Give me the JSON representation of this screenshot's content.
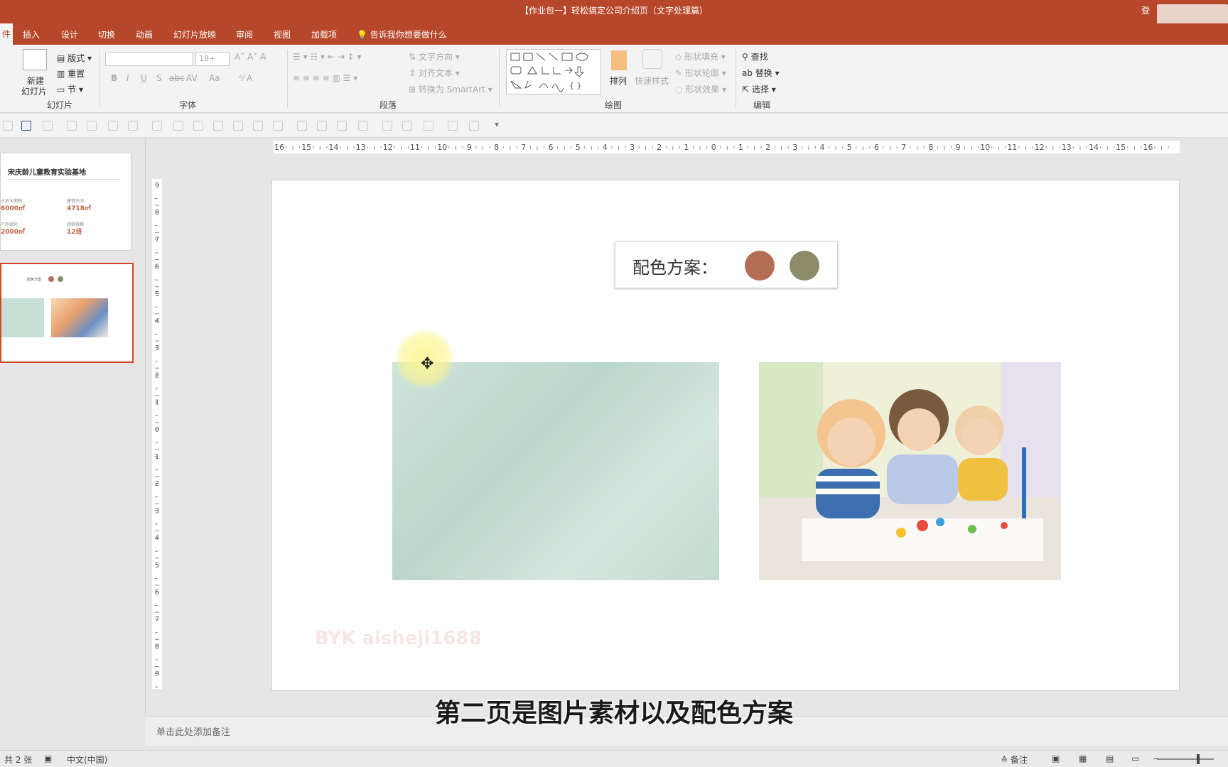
{
  "window": {
    "title": "【作业包一】轻松搞定公司介绍页（文字处理篇）",
    "login": "登"
  },
  "tabs": [
    "插入",
    "设计",
    "切换",
    "动画",
    "幻灯片放映",
    "审阅",
    "视图",
    "加载项"
  ],
  "tell_me": "告诉我你想要做什么",
  "ribbon": {
    "slides": {
      "new_slide": "新建",
      "new_slide2": "幻灯片",
      "layout": "版式",
      "reset": "重置",
      "section": "节",
      "label": "幻灯片"
    },
    "font": {
      "size": "18+",
      "bold": "B",
      "italic": "I",
      "underline": "U",
      "shadow": "S",
      "strike": "abc",
      "spacing": "AV",
      "case": "Aa",
      "label": "字体"
    },
    "paragraph": {
      "text_direction": "文字方向",
      "align_text": "对齐文本",
      "smartart": "转换为 SmartArt",
      "label": "段落"
    },
    "drawing": {
      "arrange": "排列",
      "quick_styles": "快速样式",
      "shape_fill": "形状填充",
      "shape_outline": "形状轮廓",
      "shape_effects": "形状效果",
      "label": "绘图"
    },
    "editing": {
      "find": "查找",
      "replace": "替换",
      "select": "选择",
      "label": "编辑"
    }
  },
  "thumbnails": {
    "slide1": {
      "title": "宋庆龄儿童教育实验基地",
      "stat1_label": "占地大面积",
      "stat1_value": "6000㎡",
      "stat2_label": "建筑空间",
      "stat2_value": "4718㎡",
      "stat3_label": "户外绿化",
      "stat3_value": "2000㎡",
      "stat4_label": "班级规模",
      "stat4_value": "12班"
    },
    "slide2": {
      "label": "配色方案"
    }
  },
  "ruler": {
    "horizontal": [
      "16",
      "15",
      "14",
      "13",
      "12",
      "11",
      "10",
      "9",
      "8",
      "7",
      "6",
      "5",
      "4",
      "3",
      "2",
      "1",
      "0",
      "1",
      "2",
      "3",
      "4",
      "5",
      "6",
      "7",
      "8",
      "9",
      "10",
      "11",
      "12",
      "13",
      "14",
      "15",
      "16"
    ],
    "vertical": [
      "9",
      "8",
      "7",
      "6",
      "5",
      "4",
      "3",
      "2",
      "1",
      "0",
      "1",
      "2",
      "3",
      "4",
      "5",
      "6",
      "7",
      "8",
      "9"
    ]
  },
  "slide": {
    "color_scheme_label": "配色方案：",
    "colors": [
      "#b36e55",
      "#8c8c6a"
    ],
    "watermark": "BYK aisheji1688"
  },
  "notes_placeholder": "单击此处添加备注",
  "subtitle": "第二页是图片素材以及配色方案",
  "status": {
    "slide_count": "共 2 张",
    "language": "中文(中国)",
    "notes": "备注"
  }
}
